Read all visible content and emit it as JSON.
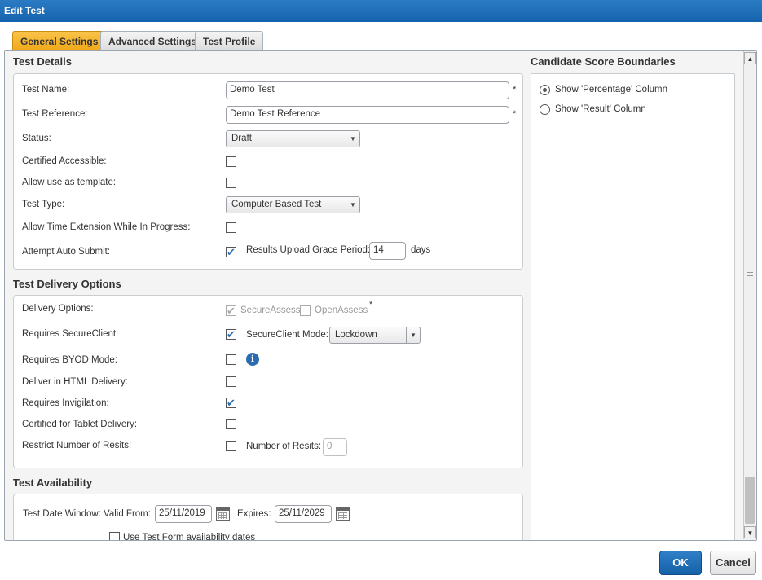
{
  "window": {
    "title": "Edit Test"
  },
  "tabs": [
    {
      "label": "General Settings",
      "active": true
    },
    {
      "label": "Advanced Settings",
      "active": false
    },
    {
      "label": "Test Profile",
      "active": false
    }
  ],
  "test_details": {
    "title": "Test Details",
    "test_name_label": "Test Name:",
    "test_name_value": "Demo Test",
    "test_reference_label": "Test Reference:",
    "test_reference_value": "Demo Test Reference",
    "required_marker": "*",
    "status_label": "Status:",
    "status_value": "Draft",
    "certified_accessible_label": "Certified Accessible:",
    "certified_accessible_checked": false,
    "allow_template_label": "Allow use as template:",
    "allow_template_checked": false,
    "test_type_label": "Test Type:",
    "test_type_value": "Computer Based Test",
    "allow_time_ext_label": "Allow Time Extension While In Progress:",
    "allow_time_ext_checked": false,
    "attempt_auto_submit_label": "Attempt Auto Submit:",
    "attempt_auto_submit_checked": true,
    "grace_period_label": "Results Upload Grace Period:",
    "grace_period_value": "14",
    "grace_period_unit": "days"
  },
  "delivery_options": {
    "title": "Test Delivery Options",
    "delivery_options_label": "Delivery Options:",
    "secureassess_label": "SecureAssess",
    "secureassess_checked": true,
    "openassess_label": "OpenAssess",
    "openassess_checked": false,
    "requires_secureclient_label": "Requires SecureClient:",
    "requires_secureclient_checked": true,
    "secureclient_mode_label": "SecureClient Mode:",
    "secureclient_mode_value": "Lockdown",
    "requires_byod_label": "Requires BYOD Mode:",
    "requires_byod_checked": false,
    "html_delivery_label": "Deliver in HTML Delivery:",
    "html_delivery_checked": false,
    "invigilation_label": "Requires Invigilation:",
    "invigilation_checked": true,
    "tablet_label": "Certified for Tablet Delivery:",
    "tablet_checked": false,
    "restrict_resits_label": "Restrict Number of Resits:",
    "restrict_resits_checked": false,
    "number_resits_label": "Number of Resits:",
    "number_resits_value": "0"
  },
  "availability": {
    "title": "Test Availability",
    "date_window_label": "Test Date Window:",
    "valid_from_label": "Valid From:",
    "valid_from_value": "25/11/2019",
    "expires_label": "Expires:",
    "expires_value": "25/11/2029",
    "use_form_dates_label": "Use Test Form availability dates"
  },
  "score_boundaries": {
    "title": "Candidate Score Boundaries",
    "show_percentage_label": "Show 'Percentage' Column",
    "show_percentage_selected": true,
    "show_result_label": "Show 'Result' Column",
    "show_result_selected": false
  },
  "footer": {
    "ok_label": "OK",
    "cancel_label": "Cancel"
  },
  "colors": {
    "title_bar": "#1f6fb8",
    "active_tab": "#f2ae25",
    "primary_button": "#1f6fb8"
  }
}
